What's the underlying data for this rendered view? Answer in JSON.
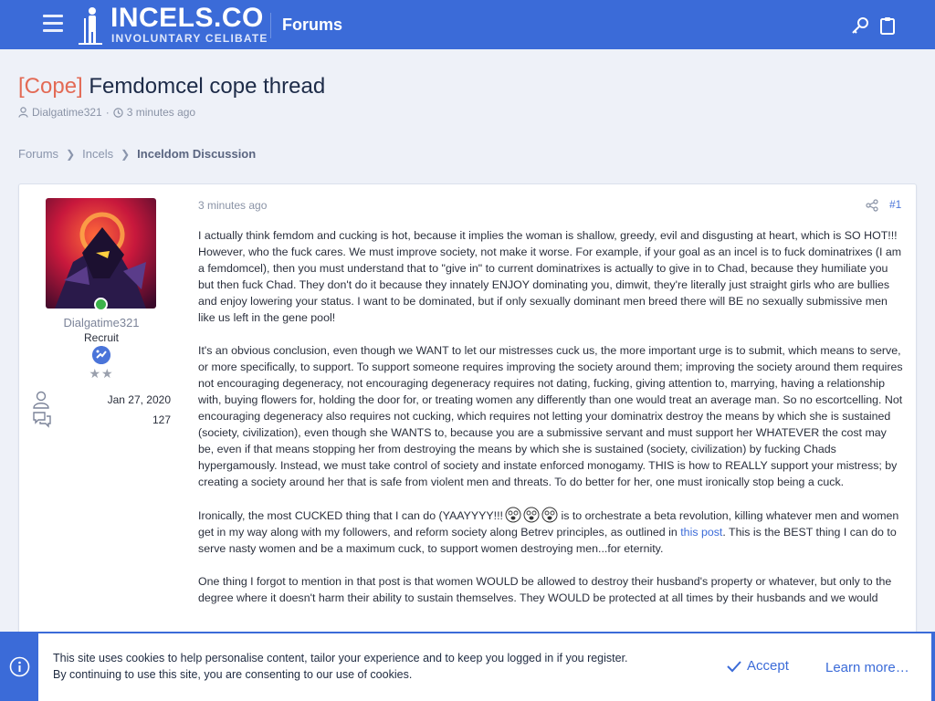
{
  "header": {
    "logo_main": "INCELS.CO",
    "logo_sub": "INVOLUNTARY CELIBATE",
    "forums_label": "Forums"
  },
  "thread": {
    "prefix": "[Cope]",
    "title": "Femdomcel cope thread",
    "author": "Dialgatime321",
    "time": "3 minutes ago"
  },
  "breadcrumb": [
    "Forums",
    "Incels",
    "Inceldom Discussion"
  ],
  "user": {
    "name": "Dialgatime321",
    "rank": "Recruit",
    "stars": "★★",
    "joined": "Jan 27, 2020",
    "messages": "127"
  },
  "post": {
    "date": "3 minutes ago",
    "number": "#1",
    "p1a": "I actually think femdom and cucking is hot, because it implies the woman is shallow, greedy, evil and disgusting at heart, which is SO HOT!!!",
    "p1b": "However, who the fuck cares. We must improve society, not make it worse. For example, if your goal as an incel is to fuck dominatrixes (I am a femdomcel), then you must understand that to \"give in\" to current dominatrixes is actually to give in to Chad, because they humiliate you but then fuck Chad. They don't do it because they innately ENJOY dominating you, dimwit, they're literally just straight girls who are bullies and enjoy lowering your status. I want to be dominated, but if only sexually dominant men breed there will BE no sexually submissive men like us left in the gene pool!",
    "p2": "It's an obvious conclusion, even though we WANT to let our mistresses cuck us, the more important urge is to submit, which means to serve, or more specifically, to support. To support someone requires improving the society around them; improving the society around them requires not encouraging degeneracy, not encouraging degeneracy requires not dating, fucking, giving attention to, marrying, having a relationship with, buying flowers for, holding the door for, or treating women any differently than one would treat an average man. So no escortcelling. Not encouraging degeneracy also requires not cucking, which requires not letting your dominatrix destroy the means by which she is sustained (society, civilization), even though she WANTS to, because you are a submissive servant and must support her WHATEVER the cost may be, even if that means stopping her from destroying the means by which she is sustained (society, civilization) by fucking Chads hypergamously. Instead, we must take control of society and instate enforced monogamy. THIS is how to REALLY support your mistress; by creating a society around her that is safe from violent men and threats. To do better for her, one must ironically stop being a cuck.",
    "p3a": "Ironically, the most CUCKED thing that I can do (YAAYYYY!!!",
    "p3b": " is to orchestrate a beta revolution, killing whatever men and women get in my way along with my followers, and reform society along Betrev principles, as outlined in ",
    "p3_link": "this post",
    "p3c": ". This is the BEST thing I can do to serve nasty women and be a maximum cuck, to support women destroying men...for eternity.",
    "p4": "One thing I forgot to mention in that post is that women WOULD be allowed to destroy their husband's property or whatever, but only to the degree where it doesn't harm their ability to sustain themselves. They WOULD be protected at all times by their husbands and we would"
  },
  "cookie": {
    "line1": "This site uses cookies to help personalise content, tailor your experience and to keep you logged in if you register.",
    "line2": "By continuing to use this site, you are consenting to our use of cookies.",
    "accept": "Accept",
    "learn_more": "Learn more…"
  },
  "colors": {
    "brand": "#3b6bd8",
    "prefix": "#e36a55",
    "online": "#3cb34a"
  }
}
